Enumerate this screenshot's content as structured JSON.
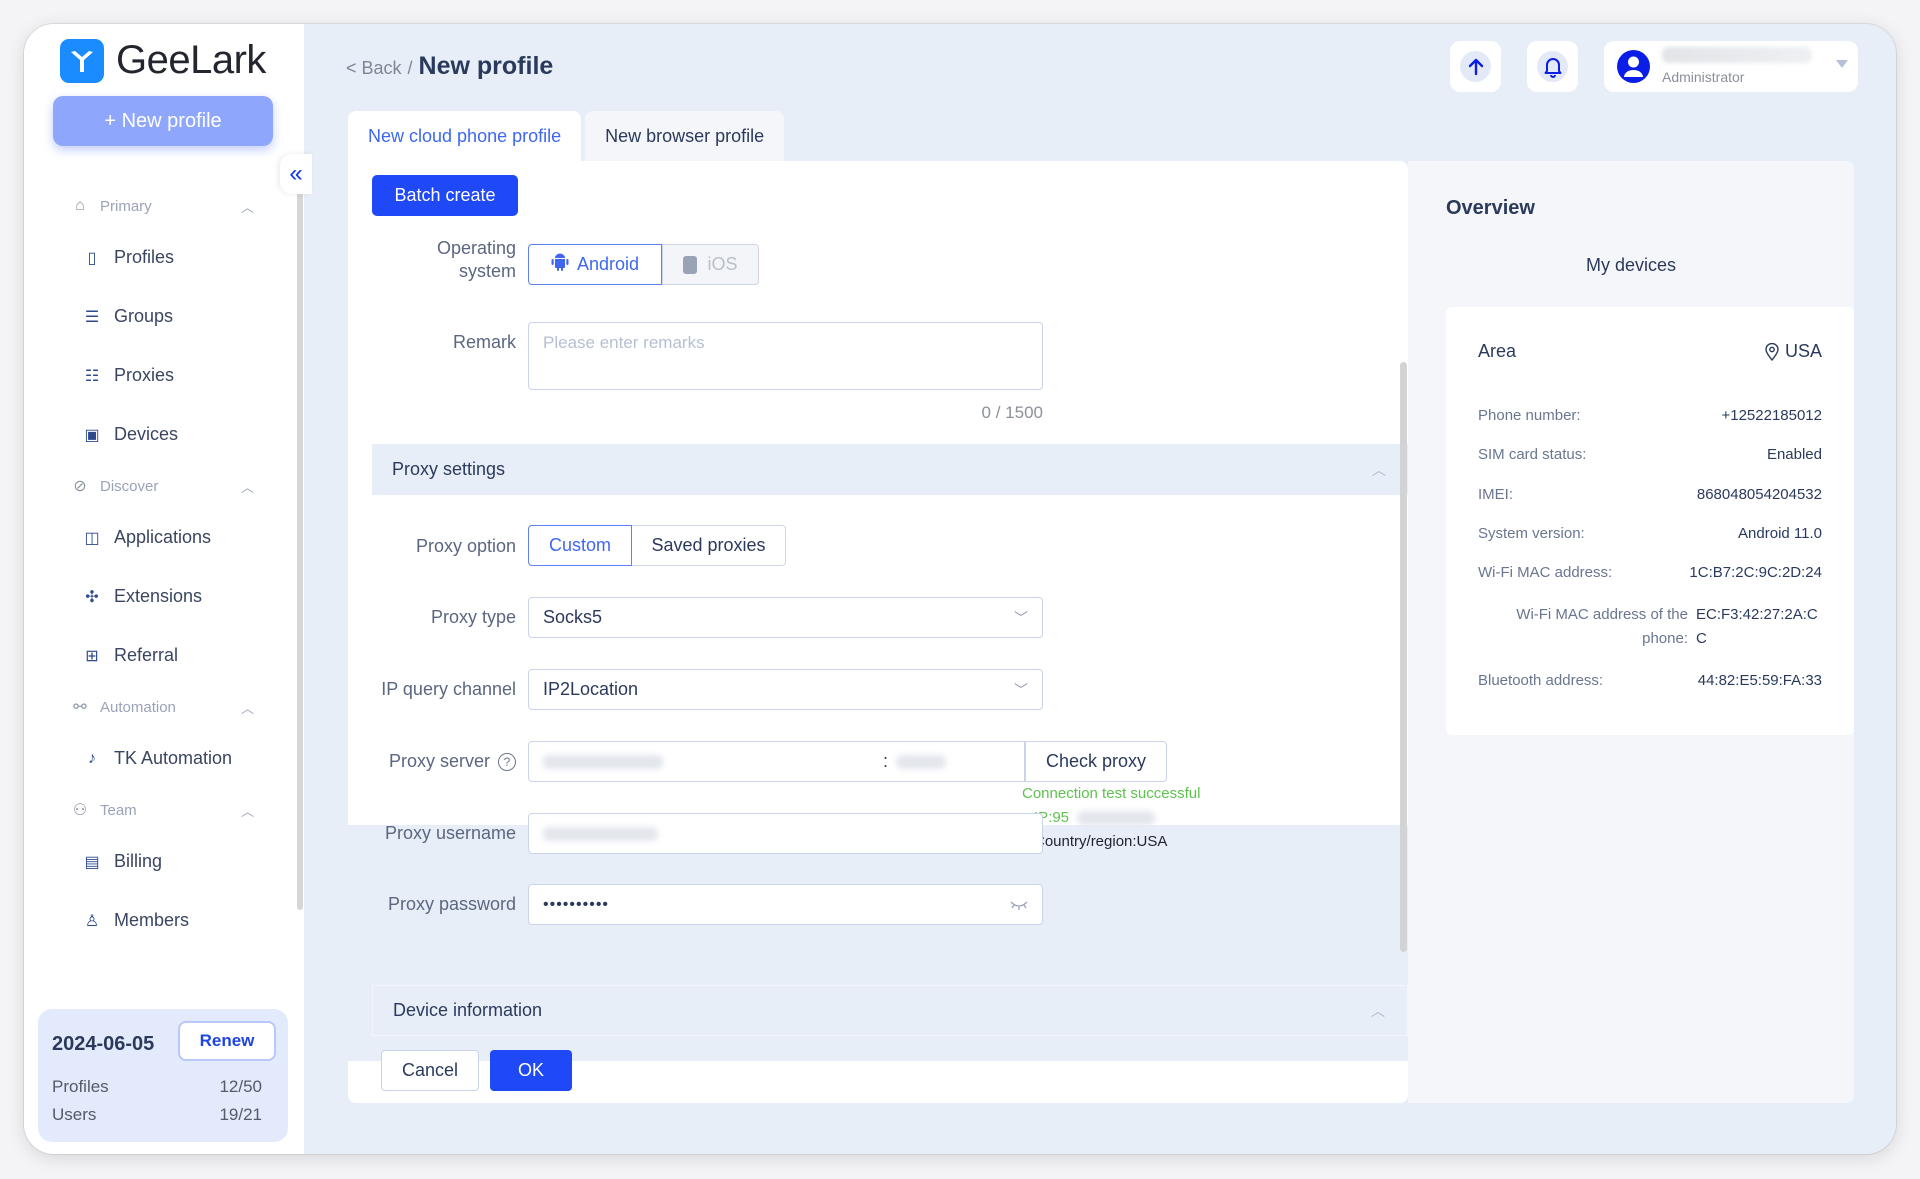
{
  "app": {
    "name": "GeeLark"
  },
  "sidebar": {
    "new_profile_label": "+ New profile",
    "collapse_icon": "«",
    "groups": [
      {
        "label": "Primary",
        "icon": "home-icon",
        "items": [
          {
            "label": "Profiles",
            "icon": "profiles-icon"
          },
          {
            "label": "Groups",
            "icon": "list-icon"
          },
          {
            "label": "Proxies",
            "icon": "network-icon"
          },
          {
            "label": "Devices",
            "icon": "devices-icon"
          }
        ]
      },
      {
        "label": "Discover",
        "icon": "planet-icon",
        "items": [
          {
            "label": "Applications",
            "icon": "applications-icon"
          },
          {
            "label": "Extensions",
            "icon": "puzzle-icon"
          },
          {
            "label": "Referral",
            "icon": "gift-icon"
          }
        ]
      },
      {
        "label": "Automation",
        "icon": "automation-icon",
        "items": [
          {
            "label": "TK Automation",
            "icon": "tiktok-icon"
          }
        ]
      },
      {
        "label": "Team",
        "icon": "team-icon",
        "items": [
          {
            "label": "Billing",
            "icon": "billing-icon"
          },
          {
            "label": "Members",
            "icon": "members-icon"
          }
        ]
      }
    ],
    "plan": {
      "expiry_date": "2024-06-05",
      "renew_label": "Renew",
      "profiles_label": "Profiles",
      "profiles_value": "12/50",
      "users_label": "Users",
      "users_value": "19/21"
    }
  },
  "header": {
    "back_label": "< Back",
    "separator": "/",
    "title": "New profile",
    "user_role": "Administrator"
  },
  "tabs": [
    {
      "label": "New cloud phone profile",
      "active": true
    },
    {
      "label": "New browser profile",
      "active": false
    }
  ],
  "form": {
    "batch_create_label": "Batch create",
    "os_label_line1": "Operating",
    "os_label_line2": "system",
    "os_options": [
      {
        "label": "Android",
        "selected": true
      },
      {
        "label": "iOS",
        "selected": false,
        "disabled": true
      }
    ],
    "remark_label": "Remark",
    "remark_placeholder": "Please enter remarks",
    "remark_counter": "0 / 1500",
    "proxy_section_title": "Proxy settings",
    "proxy_option_label": "Proxy option",
    "proxy_options": [
      {
        "label": "Custom",
        "selected": true
      },
      {
        "label": "Saved proxies",
        "selected": false
      }
    ],
    "proxy_type_label": "Proxy type",
    "proxy_type_value": "Socks5",
    "ip_query_label": "IP query channel",
    "ip_query_value": "IP2Location",
    "proxy_server_label": "Proxy server",
    "proxy_server_port_sep": ":",
    "check_proxy_label": "Check proxy",
    "connection_status": "Connection test successful",
    "ip_prefix": "IP:95",
    "country_region": "Country/region:USA",
    "proxy_username_label": "Proxy username",
    "proxy_password_label": "Proxy password",
    "proxy_password_value": "••••••••••",
    "device_section_title": "Device information",
    "cancel_label": "Cancel",
    "ok_label": "OK"
  },
  "overview": {
    "title": "Overview",
    "subtitle": "My devices",
    "area_label": "Area",
    "area_value": "USA",
    "rows": [
      {
        "label": "Phone number:",
        "value": "+12522185012"
      },
      {
        "label": "SIM card status:",
        "value": "Enabled"
      },
      {
        "label": "IMEI:",
        "value": "868048054204532"
      },
      {
        "label": "System version:",
        "value": "Android 11.0"
      },
      {
        "label": "Wi-Fi MAC address:",
        "value": "1C:B7:2C:9C:2D:24"
      },
      {
        "label": "Wi-Fi MAC address of the phone:",
        "value": "EC:F3:42:27:2A:CC"
      },
      {
        "label": "Bluetooth address:",
        "value": "44:82:E5:59:FA:33"
      }
    ]
  },
  "colors": {
    "primary": "#1f48f7",
    "success": "#5ec24f",
    "sidebar_button": "#8ea6fb",
    "background": "#e8eef8"
  }
}
